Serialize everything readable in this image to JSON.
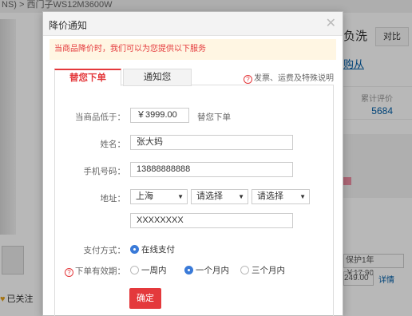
{
  "background": {
    "breadcrumb": "NS) > 西门子WS12M3600W",
    "title_partial": "负洗",
    "compare_label": "对比",
    "buy_link": "购从",
    "review_label": "累计评价",
    "review_count": "5684",
    "warranty": "保护1年 ￥17.90",
    "price_partial": "249.00",
    "detail_link": "详情",
    "follow_label": "已关注"
  },
  "dialog": {
    "title": "降价通知",
    "notice": "当商品降价时，我们可以为您提供以下服务",
    "tabs": [
      {
        "label": "替您下单",
        "active": true
      },
      {
        "label": "通知您",
        "active": false
      }
    ],
    "help_text": "发票、运费及特殊说明",
    "form": {
      "price_label": "当商品低于：",
      "price_value": "￥3999.00",
      "price_suffix": "替您下单",
      "name_label": "姓名：",
      "name_value": "张大妈",
      "phone_label": "手机号码：",
      "phone_value": "13888888888",
      "address_label": "地址：",
      "address_province": "上海",
      "address_city": "请选择",
      "address_district": "请选择",
      "address_detail": "XXXXXXXX",
      "payment_label": "支付方式：",
      "payment_value": "在线支付",
      "validity_label": "下单有效期：",
      "validity_options": [
        "一周内",
        "一个月内",
        "三个月内"
      ],
      "validity_selected": 1,
      "submit_label": "确定"
    }
  },
  "colors": {
    "accent": "#e4393c",
    "link": "#005ea7",
    "notice_bg": "#fff6e3",
    "radio_on": "#3a7ad8"
  }
}
